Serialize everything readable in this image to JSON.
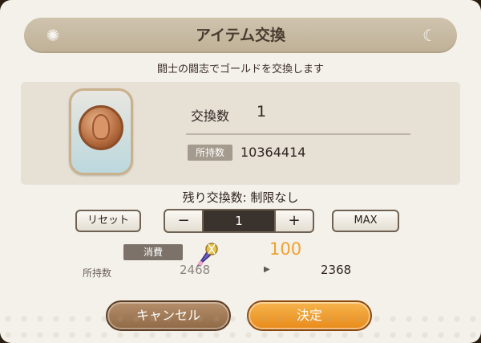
{
  "dialog": {
    "title": "アイテム交換",
    "subtitle": "闘士の闘志でゴールドを交換します"
  },
  "item": {
    "exchange_label": "交換数",
    "exchange_count": "1",
    "owned_label": "所持数",
    "owned_value": "10364414",
    "icon": "gold-coin-medal-icon"
  },
  "remaining": "残り交換数: 制限なし",
  "controls": {
    "reset_label": "リセット",
    "minus_label": "−",
    "quantity": "1",
    "plus_label": "+",
    "max_label": "MAX"
  },
  "cost": {
    "consume_label": "消費",
    "item_icon": "fighter-spirit-icon",
    "amount": "100",
    "owned_label": "所持数",
    "before": "2468",
    "arrow": "▶",
    "after": "2368",
    "accent_color": "#f0a130"
  },
  "buttons": {
    "cancel_label": "キャンセル",
    "ok_label": "決定"
  }
}
